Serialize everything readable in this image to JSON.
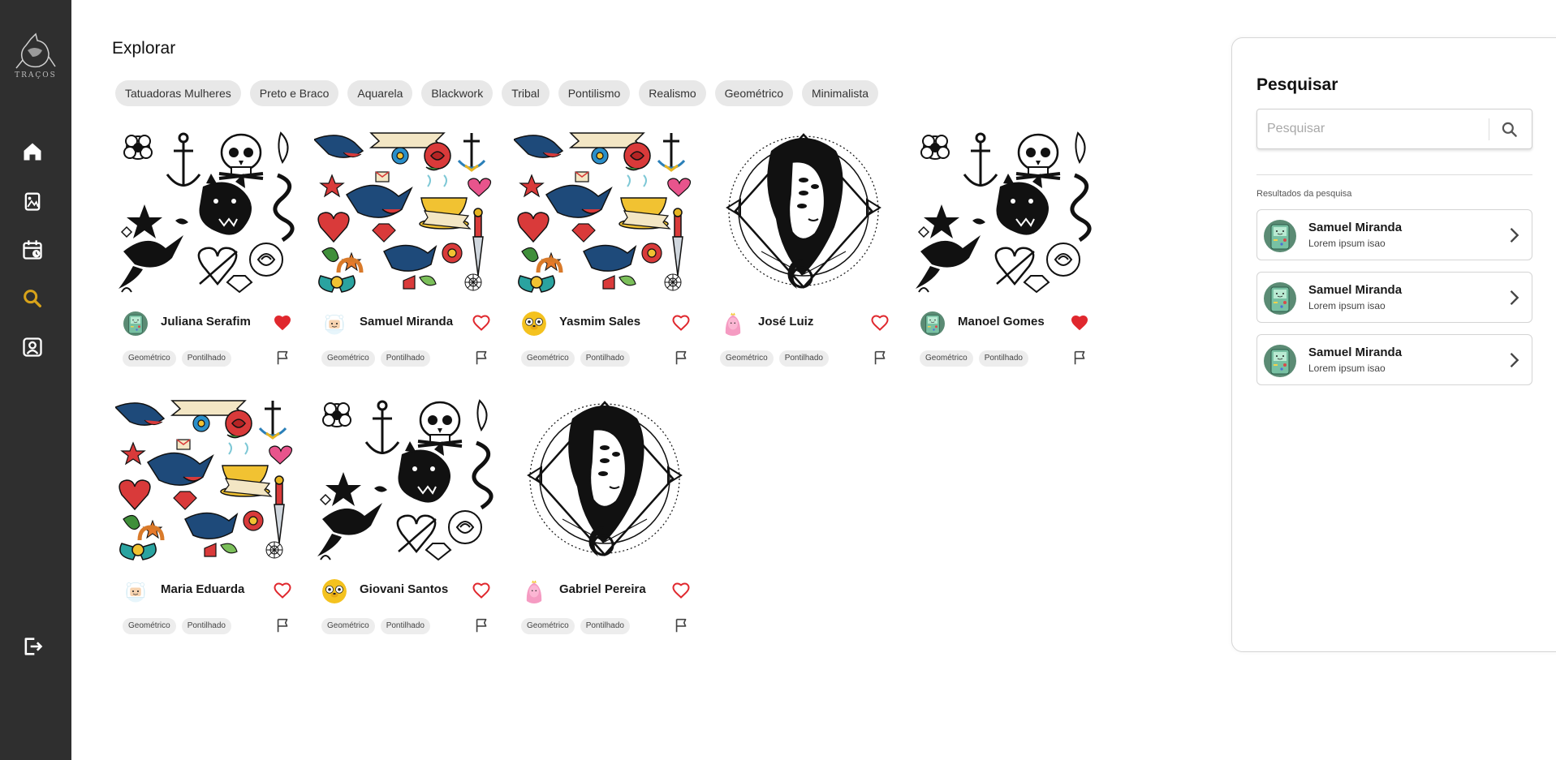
{
  "app": {
    "logo_text": "TRAÇOS"
  },
  "sidebar": {
    "items": [
      {
        "name": "home-icon",
        "active": false
      },
      {
        "name": "gallery-icon",
        "active": false
      },
      {
        "name": "calendar-icon",
        "active": false
      },
      {
        "name": "search-icon",
        "active": true
      },
      {
        "name": "profile-icon",
        "active": false
      }
    ],
    "logout_icon": "logout-icon",
    "icon_color": "#ffffff",
    "active_color": "#d8a31a"
  },
  "main": {
    "title": "Explorar",
    "chips": [
      "Tatuadoras Mulheres",
      "Preto e Braco",
      "Aquarela",
      "Blackwork",
      "Tribal",
      "Pontilismo",
      "Realismo",
      "Geométrico",
      "Minimalista"
    ],
    "cards": [
      {
        "artist": "Juliana Serafim",
        "image": "blackwork-flash",
        "avatar": "bmo",
        "liked": true,
        "tags": [
          "Geométrico",
          "Pontilhado"
        ]
      },
      {
        "artist": "Samuel Miranda",
        "image": "color-flash",
        "avatar": "finn",
        "liked": false,
        "tags": [
          "Geométrico",
          "Pontilhado"
        ]
      },
      {
        "artist": "Yasmim Sales",
        "image": "color-flash",
        "avatar": "jake",
        "liked": false,
        "tags": [
          "Geométrico",
          "Pontilhado"
        ]
      },
      {
        "artist": "José Luiz",
        "image": "portrait-geometric",
        "avatar": "princess",
        "liked": false,
        "tags": [
          "Geométrico",
          "Pontilhado"
        ]
      },
      {
        "artist": "Manoel Gomes",
        "image": "blackwork-flash",
        "avatar": "bmo",
        "liked": true,
        "tags": [
          "Geométrico",
          "Pontilhado"
        ]
      },
      {
        "artist": "Maria Eduarda",
        "image": "color-flash",
        "avatar": "finn",
        "liked": false,
        "tags": [
          "Geométrico",
          "Pontilhado"
        ]
      },
      {
        "artist": "Giovani Santos",
        "image": "blackwork-flash",
        "avatar": "jake",
        "liked": false,
        "tags": [
          "Geométrico",
          "Pontilhado"
        ]
      },
      {
        "artist": "Gabriel Pereira",
        "image": "portrait-geometric",
        "avatar": "princess",
        "liked": false,
        "tags": [
          "Geométrico",
          "Pontilhado"
        ]
      }
    ],
    "heart_color": "#e0282e"
  },
  "search_panel": {
    "title": "Pesquisar",
    "placeholder": "Pesquisar",
    "value": "",
    "results_label": "Resultados da pesquisa",
    "results": [
      {
        "name": "Samuel Miranda",
        "subtitle": "Lorem ipsum isao",
        "avatar": "bmo"
      },
      {
        "name": "Samuel Miranda",
        "subtitle": "Lorem ipsum isao",
        "avatar": "bmo"
      },
      {
        "name": "Samuel Miranda",
        "subtitle": "Lorem ipsum isao",
        "avatar": "bmo"
      }
    ]
  }
}
